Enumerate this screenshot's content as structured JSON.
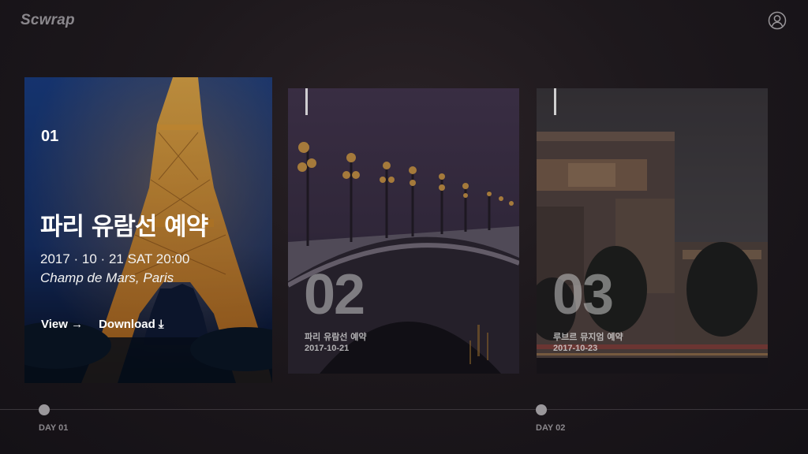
{
  "app": {
    "logo": "Scwrap"
  },
  "header": {
    "profile_icon": "user-circle-icon"
  },
  "cards": [
    {
      "number": "01",
      "title": "파리 유람선 예약",
      "date": "2017 · 10 · 21  SAT 20:00",
      "place": "Champ de Mars, Paris",
      "view_label": "View →",
      "download_label": "Download ⤓"
    },
    {
      "number": "02",
      "title": "파리 유람선 예약",
      "date": "2017-10-21"
    },
    {
      "number": "03",
      "title": "루브르 뮤지엄 예약",
      "date": "2017-10-23"
    }
  ],
  "timeline": {
    "days": [
      {
        "label": "DAY 01"
      },
      {
        "label": "DAY 02"
      }
    ]
  },
  "colors": {
    "background": "#1d181c",
    "muted_text": "#8a878c",
    "accent_white": "#ffffff"
  }
}
